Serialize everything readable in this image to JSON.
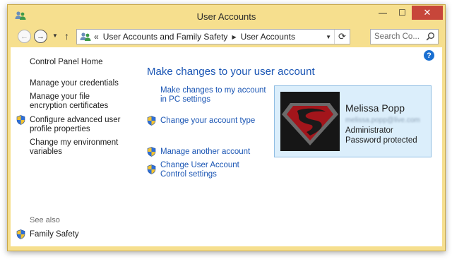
{
  "window": {
    "title": "User Accounts"
  },
  "caption_buttons": {
    "minimize": "—",
    "maximize": "☐",
    "close": "✕"
  },
  "nav": {
    "back": "←",
    "forward": "→",
    "recent": "▼",
    "up": "↑",
    "address_prefix": "«",
    "breadcrumb": [
      "User Accounts and Family Safety",
      "User Accounts"
    ],
    "separator": "▶",
    "dropdown": "▼",
    "refresh": "⟳",
    "search_placeholder": "Search Co..."
  },
  "help": "?",
  "sidebar": {
    "home": "Control Panel Home",
    "links": [
      "Manage your credentials",
      "Manage your file encryption certificates",
      "Configure advanced user profile properties",
      "Change my environment variables"
    ],
    "see_also_label": "See also",
    "see_also_links": [
      "Family Safety"
    ]
  },
  "main": {
    "heading": "Make changes to your user account",
    "actions": [
      "Make changes to my account in PC settings",
      "Change your account type",
      "Manage another account",
      "Change User Account Control settings"
    ]
  },
  "user": {
    "name": "Melissa Popp",
    "email": "melissa.popp@live.com",
    "role": "Administrator",
    "status": "Password protected"
  },
  "icons": {
    "app": "user-accounts-icon",
    "shield": "uac-shield-icon",
    "search": "search-icon",
    "help": "help-icon"
  },
  "colors": {
    "window_frame": "#f6df8e",
    "link": "#1a55b4",
    "card_bg": "#dbeefb",
    "close_button": "#c7463a"
  }
}
